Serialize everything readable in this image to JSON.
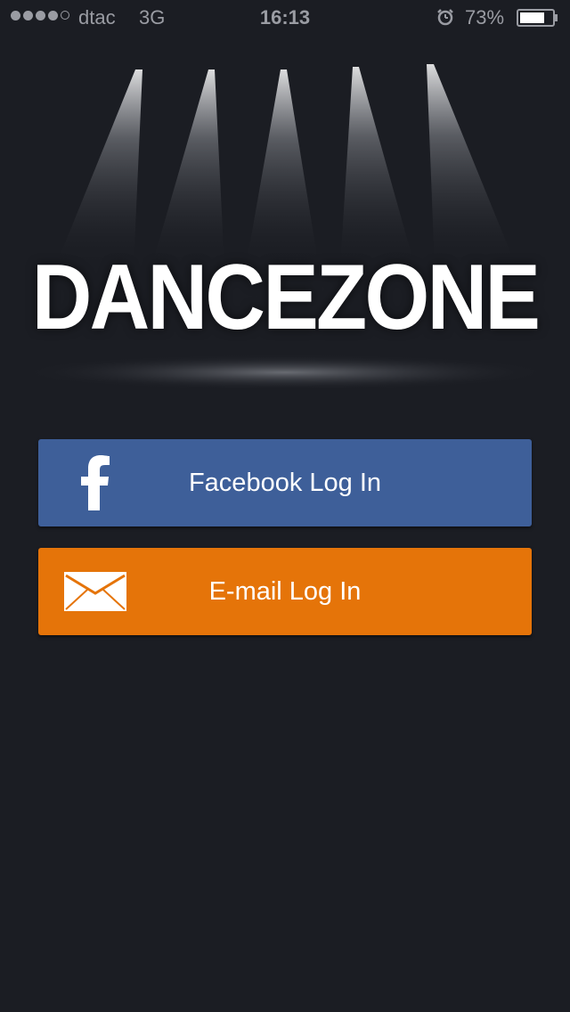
{
  "status_bar": {
    "carrier": "dtac",
    "network": "3G",
    "time": "16:13",
    "battery": "73%",
    "signal_bars": 4,
    "signal_max": 5
  },
  "brand": {
    "logo_text": "DANCEZONE"
  },
  "buttons": {
    "facebook": {
      "label": "Facebook Log In",
      "color": "#3e5f99",
      "icon": "facebook-icon"
    },
    "email": {
      "label": "E-mail Log In",
      "color": "#e57409",
      "icon": "envelope-icon"
    }
  },
  "colors": {
    "background": "#1b1d23",
    "text": "#ffffff"
  }
}
